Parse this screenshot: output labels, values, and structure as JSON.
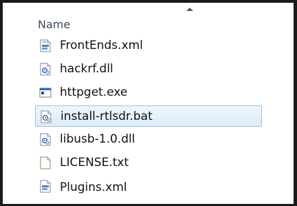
{
  "header": {
    "column_name": "Name"
  },
  "files": [
    {
      "name": "FrontEnds.xml",
      "icon": "xml-file-icon",
      "selected": false
    },
    {
      "name": "hackrf.dll",
      "icon": "dll-file-icon",
      "selected": false
    },
    {
      "name": "httpget.exe",
      "icon": "exe-file-icon",
      "selected": false
    },
    {
      "name": "install-rtlsdr.bat",
      "icon": "bat-file-icon",
      "selected": true
    },
    {
      "name": "libusb-1.0.dll",
      "icon": "dll-file-icon",
      "selected": false
    },
    {
      "name": "LICENSE.txt",
      "icon": "txt-file-icon",
      "selected": false
    },
    {
      "name": "Plugins.xml",
      "icon": "xml-file-icon",
      "selected": false
    }
  ],
  "colors": {
    "selection_fill": "#dcebf8",
    "selection_border": "#9dc3e3",
    "header_text": "#3a4a60"
  }
}
